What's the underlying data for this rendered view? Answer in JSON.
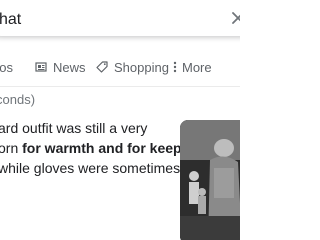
{
  "search": {
    "query_visible": "hat"
  },
  "tabs": [
    {
      "label": "eos",
      "icon": "video-icon"
    },
    {
      "label": "News",
      "icon": "news-icon"
    },
    {
      "label": "Shopping",
      "icon": "tag-icon"
    },
    {
      "label": "More",
      "icon": "more-vert-icon"
    }
  ],
  "result_stats": "conds)",
  "featured_snippet": {
    "line1": "ard outfit was still a very",
    "line2_prefix": "orn ",
    "line2_bold": "for warmth and for keeping",
    "line3": "while gloves were sometimes"
  },
  "colors": {
    "text": "#202124",
    "secondary": "#5f6368",
    "muted": "#70757a"
  }
}
